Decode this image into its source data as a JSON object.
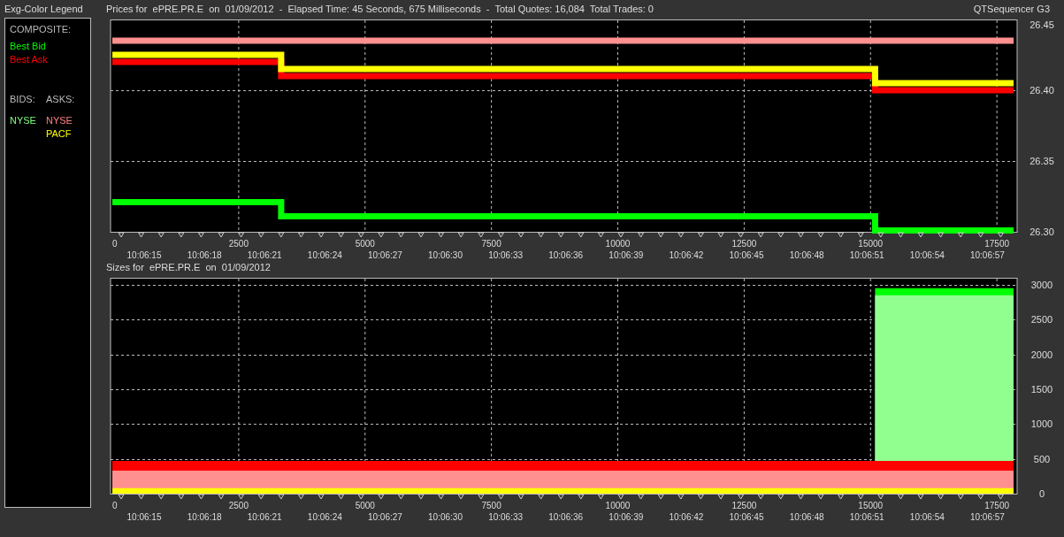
{
  "legend": {
    "title": "Exg-Color Legend",
    "composite_label": "COMPOSITE:",
    "composite": [
      {
        "label": "Best Bid",
        "color": "#00ff00"
      },
      {
        "label": "Best Ask",
        "color": "#ff0000"
      }
    ],
    "bids_label": "BIDS:",
    "asks_label": "ASKS:",
    "bids": [
      {
        "label": "NYSE",
        "color": "#80ff80"
      }
    ],
    "asks": [
      {
        "label": "NYSE",
        "color": "#ff8080"
      },
      {
        "label": "PACF",
        "color": "#ffff00"
      }
    ]
  },
  "prices": {
    "title": "Prices for  ePRE.PR.E  on  01/09/2012  -  Elapsed Time: 45 Seconds, 675 Milliseconds  -  Total Quotes: 16,084  Total Trades: 0",
    "app_name": "QTSequencer G3",
    "time_labels": [
      "10:06:15",
      "10:06:18",
      "10:06:21",
      "10:06:24",
      "10:06:27",
      "10:06:30",
      "10:06:33",
      "10:06:36",
      "10:06:39",
      "10:06:42",
      "10:06:45",
      "10:06:48",
      "10:06:51",
      "10:06:54",
      "10:06:57"
    ],
    "chart_data": {
      "type": "line",
      "grid": true,
      "x": [
        0,
        3340,
        3340,
        15090,
        15090,
        17830
      ],
      "xlim": [
        0,
        17900
      ],
      "ylim": [
        26.3,
        26.45
      ],
      "xticks": [
        0,
        2500,
        5000,
        7500,
        10000,
        12500,
        15000,
        17500
      ],
      "yticks": [
        {
          "value": 26.3,
          "label": "26.30"
        },
        {
          "value": 26.35,
          "label": "26.35"
        },
        {
          "value": 26.4,
          "label": "26.40"
        },
        {
          "value": 26.45,
          "label": "26.45"
        }
      ],
      "series": [
        {
          "color": "#ff9090",
          "values": [
            26.435,
            26.435,
            26.435,
            26.435,
            26.435,
            26.435
          ]
        },
        {
          "color": "#ff0000",
          "values": [
            26.42,
            26.42,
            26.41,
            26.41,
            26.4,
            26.4
          ]
        },
        {
          "color": "#ffff00",
          "values": [
            26.425,
            26.425,
            26.415,
            26.415,
            26.405,
            26.405
          ]
        },
        {
          "color": "#00ff00",
          "values": [
            26.321,
            26.321,
            26.311,
            26.311,
            26.301,
            26.301
          ]
        }
      ]
    }
  },
  "sizes": {
    "title": "Sizes for  ePRE.PR.E  on  01/09/2012",
    "time_labels": [
      "10:06:15",
      "10:06:18",
      "10:06:21",
      "10:06:24",
      "10:06:27",
      "10:06:30",
      "10:06:33",
      "10:06:36",
      "10:06:39",
      "10:06:42",
      "10:06:45",
      "10:06:48",
      "10:06:51",
      "10:06:54",
      "10:06:57"
    ],
    "chart_data": {
      "type": "area",
      "grid": true,
      "x": [
        0,
        15090,
        17830
      ],
      "xlim": [
        0,
        17900
      ],
      "ylim": [
        0,
        3100
      ],
      "xticks": [
        0,
        2500,
        5000,
        7500,
        10000,
        12500,
        15000,
        17500
      ],
      "yticks": [
        0,
        500,
        1000,
        1500,
        2000,
        2500,
        3000
      ],
      "series": [
        {
          "color": "#00ff00",
          "values": [
            null,
            2950,
            2950
          ]
        },
        {
          "color": "#90ff90",
          "values": [
            null,
            2850,
            2850
          ]
        },
        {
          "color": "#ff0000",
          "values": [
            470,
            470,
            470
          ]
        },
        {
          "color": "#ff9090",
          "values": [
            330,
            330,
            330
          ]
        },
        {
          "color": "#ffff00",
          "values": [
            80,
            80,
            80
          ]
        }
      ]
    }
  }
}
